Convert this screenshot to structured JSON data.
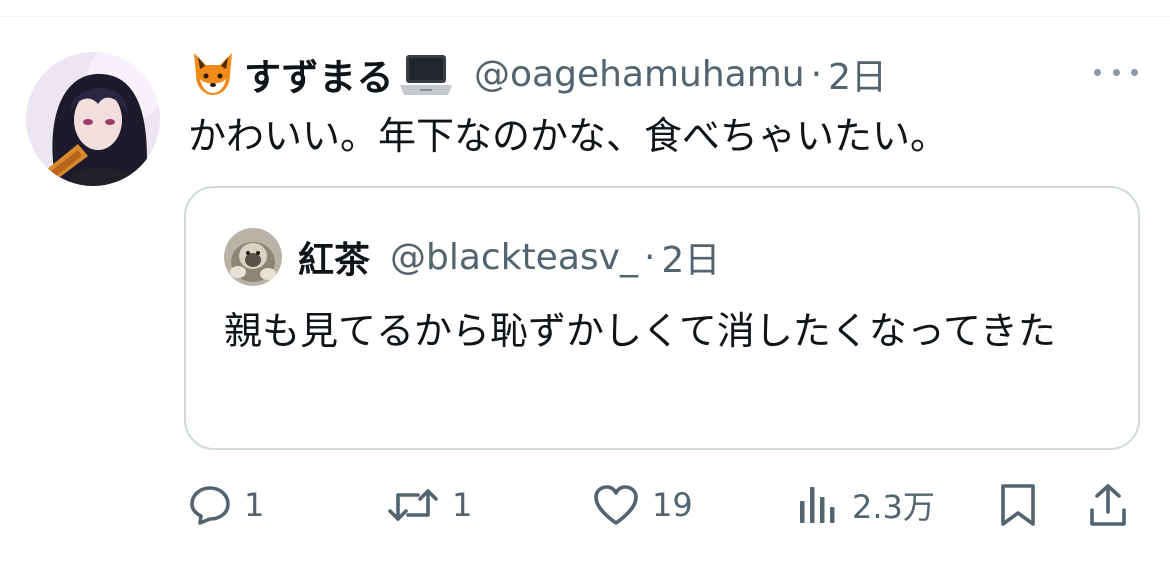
{
  "tweet": {
    "display_name": "すずまる",
    "name_emoji_left": "fox-face-emoji",
    "name_emoji_right": "laptop-emoji",
    "handle": "@oagehamuhamu",
    "separator": "·",
    "time": "2日",
    "text": "かわいい。年下なのかな、食べちゃいたい。"
  },
  "quoted": {
    "display_name": "紅茶",
    "handle": "@blackteasv_",
    "separator": "·",
    "time": "2日",
    "text": "親も見てるから恥ずかしくて消したくなってきた"
  },
  "actions": {
    "reply_count": "1",
    "retweet_count": "1",
    "like_count": "19",
    "views_count": "2.3万"
  },
  "icons": {
    "more": "more-horizontal-icon",
    "reply": "reply-bubble-icon",
    "retweet": "retweet-arrows-icon",
    "like": "heart-icon",
    "views": "bar-chart-icon",
    "bookmark": "bookmark-icon",
    "share": "share-upload-icon"
  },
  "colors": {
    "text_primary": "#0f1419",
    "text_secondary": "#536471",
    "border": "#cfd9de"
  }
}
